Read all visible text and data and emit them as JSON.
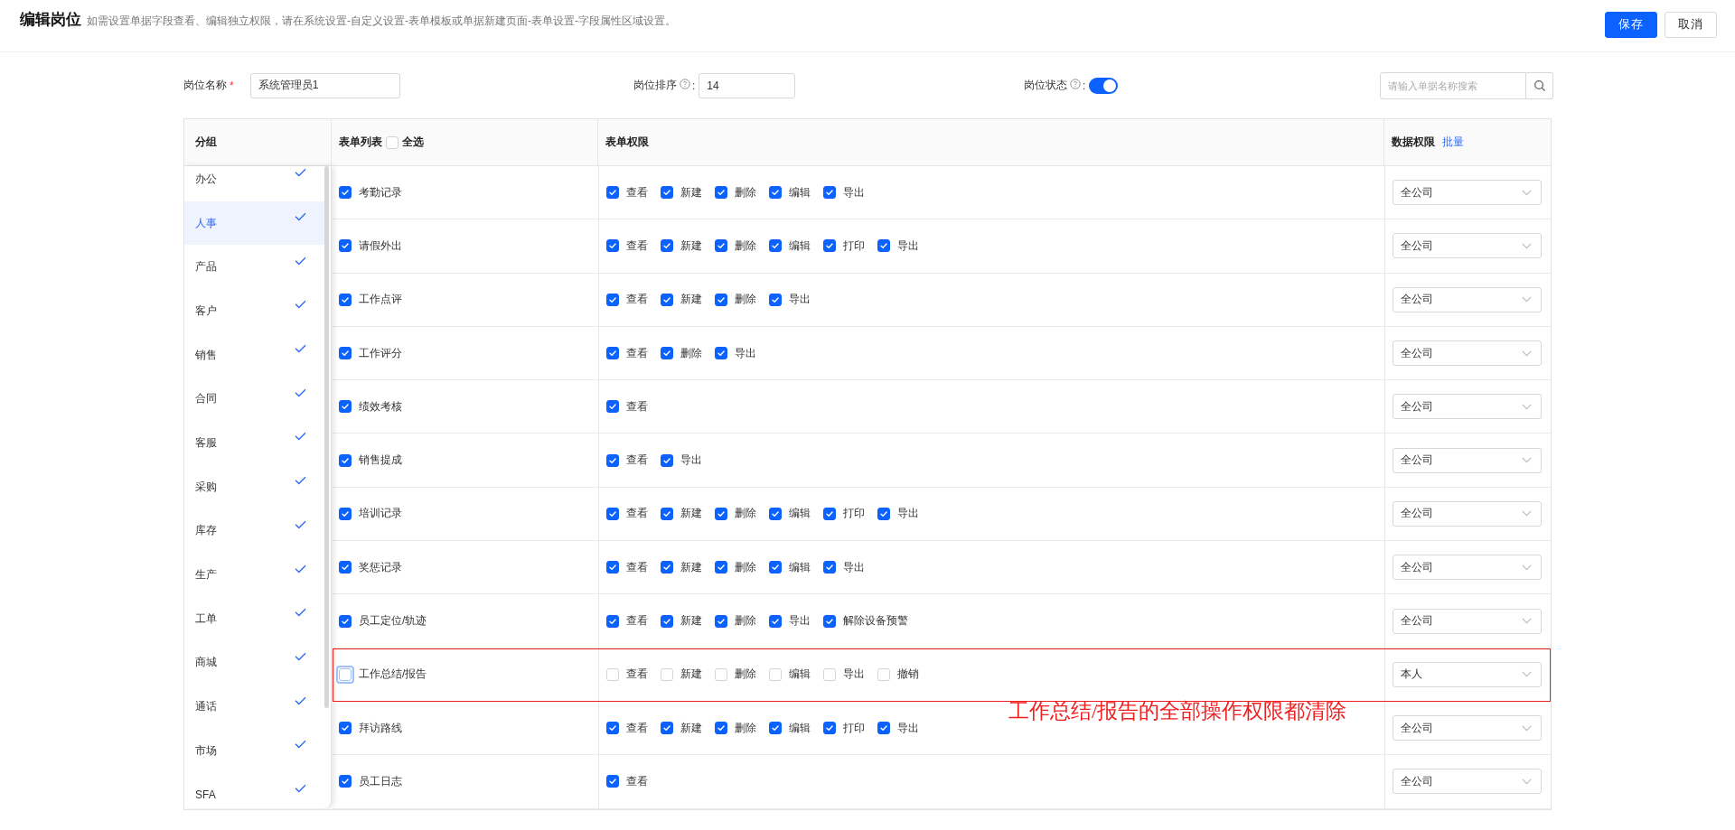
{
  "header": {
    "title": "编辑岗位",
    "subtitle": "如需设置单据字段查看、编辑独立权限，请在系统设置-自定义设置-表单模板或单据新建页面-表单设置-字段属性区域设置。",
    "buttons": [
      {
        "label": "保存",
        "kind": "primary"
      },
      {
        "label": "取消",
        "kind": "default"
      }
    ]
  },
  "form": {
    "name": {
      "label": "岗位名称",
      "required_mark": "*",
      "value": "系统管理员1"
    },
    "order": {
      "label": "岗位排序",
      "separator": ":",
      "value": "14"
    },
    "status": {
      "label": "岗位状态",
      "separator": ":",
      "on": true
    },
    "search": {
      "placeholder": "请输入单据名称搜索"
    }
  },
  "table": {
    "columns": {
      "group": "分组",
      "forms": "表单列表",
      "select_all": {
        "label": "全选",
        "checked": false
      },
      "permissions": "表单权限",
      "scope": "数据权限",
      "batch_link": "批量"
    },
    "groups": [
      {
        "label": "办公",
        "selected": false,
        "checked": true
      },
      {
        "label": "人事",
        "selected": true,
        "checked": true
      },
      {
        "label": "产品",
        "selected": false,
        "checked": true
      },
      {
        "label": "客户",
        "selected": false,
        "checked": true
      },
      {
        "label": "销售",
        "selected": false,
        "checked": true
      },
      {
        "label": "合同",
        "selected": false,
        "checked": true
      },
      {
        "label": "客服",
        "selected": false,
        "checked": true
      },
      {
        "label": "采购",
        "selected": false,
        "checked": true
      },
      {
        "label": "库存",
        "selected": false,
        "checked": true
      },
      {
        "label": "生产",
        "selected": false,
        "checked": true
      },
      {
        "label": "工单",
        "selected": false,
        "checked": true
      },
      {
        "label": "商城",
        "selected": false,
        "checked": true
      },
      {
        "label": "通话",
        "selected": false,
        "checked": true
      },
      {
        "label": "市场",
        "selected": false,
        "checked": true
      },
      {
        "label": "SFA",
        "selected": false,
        "checked": true
      }
    ],
    "rows": [
      {
        "name": "考勤记录",
        "checked": true,
        "focused": false,
        "highlighted": false,
        "scope": "全公司",
        "permissions": [
          {
            "label": "查看",
            "checked": true
          },
          {
            "label": "新建",
            "checked": true
          },
          {
            "label": "删除",
            "checked": true
          },
          {
            "label": "编辑",
            "checked": true
          },
          {
            "label": "导出",
            "checked": true
          }
        ]
      },
      {
        "name": "请假外出",
        "checked": true,
        "focused": false,
        "highlighted": false,
        "scope": "全公司",
        "permissions": [
          {
            "label": "查看",
            "checked": true
          },
          {
            "label": "新建",
            "checked": true
          },
          {
            "label": "删除",
            "checked": true
          },
          {
            "label": "编辑",
            "checked": true
          },
          {
            "label": "打印",
            "checked": true
          },
          {
            "label": "导出",
            "checked": true
          }
        ]
      },
      {
        "name": "工作点评",
        "checked": true,
        "focused": false,
        "highlighted": false,
        "scope": "全公司",
        "permissions": [
          {
            "label": "查看",
            "checked": true
          },
          {
            "label": "新建",
            "checked": true
          },
          {
            "label": "删除",
            "checked": true
          },
          {
            "label": "导出",
            "checked": true
          }
        ]
      },
      {
        "name": "工作评分",
        "checked": true,
        "focused": false,
        "highlighted": false,
        "scope": "全公司",
        "permissions": [
          {
            "label": "查看",
            "checked": true
          },
          {
            "label": "删除",
            "checked": true
          },
          {
            "label": "导出",
            "checked": true
          }
        ]
      },
      {
        "name": "绩效考核",
        "checked": true,
        "focused": false,
        "highlighted": false,
        "scope": "全公司",
        "permissions": [
          {
            "label": "查看",
            "checked": true
          }
        ]
      },
      {
        "name": "销售提成",
        "checked": true,
        "focused": false,
        "highlighted": false,
        "scope": "全公司",
        "permissions": [
          {
            "label": "查看",
            "checked": true
          },
          {
            "label": "导出",
            "checked": true
          }
        ]
      },
      {
        "name": "培训记录",
        "checked": true,
        "focused": false,
        "highlighted": false,
        "scope": "全公司",
        "permissions": [
          {
            "label": "查看",
            "checked": true
          },
          {
            "label": "新建",
            "checked": true
          },
          {
            "label": "删除",
            "checked": true
          },
          {
            "label": "编辑",
            "checked": true
          },
          {
            "label": "打印",
            "checked": true
          },
          {
            "label": "导出",
            "checked": true
          }
        ]
      },
      {
        "name": "奖惩记录",
        "checked": true,
        "focused": false,
        "highlighted": false,
        "scope": "全公司",
        "permissions": [
          {
            "label": "查看",
            "checked": true
          },
          {
            "label": "新建",
            "checked": true
          },
          {
            "label": "删除",
            "checked": true
          },
          {
            "label": "编辑",
            "checked": true
          },
          {
            "label": "导出",
            "checked": true
          }
        ]
      },
      {
        "name": "员工定位/轨迹",
        "checked": true,
        "focused": false,
        "highlighted": false,
        "scope": "全公司",
        "permissions": [
          {
            "label": "查看",
            "checked": true
          },
          {
            "label": "新建",
            "checked": true
          },
          {
            "label": "删除",
            "checked": true
          },
          {
            "label": "导出",
            "checked": true
          },
          {
            "label": "解除设备预警",
            "checked": true
          }
        ]
      },
      {
        "name": "工作总结/报告",
        "checked": false,
        "focused": true,
        "highlighted": true,
        "scope": "本人",
        "permissions": [
          {
            "label": "查看",
            "checked": false
          },
          {
            "label": "新建",
            "checked": false
          },
          {
            "label": "删除",
            "checked": false
          },
          {
            "label": "编辑",
            "checked": false
          },
          {
            "label": "导出",
            "checked": false
          },
          {
            "label": "撤销",
            "checked": false
          }
        ]
      },
      {
        "name": "拜访路线",
        "checked": true,
        "focused": false,
        "highlighted": false,
        "scope": "全公司",
        "permissions": [
          {
            "label": "查看",
            "checked": true
          },
          {
            "label": "新建",
            "checked": true
          },
          {
            "label": "删除",
            "checked": true
          },
          {
            "label": "编辑",
            "checked": true
          },
          {
            "label": "打印",
            "checked": true
          },
          {
            "label": "导出",
            "checked": true
          }
        ]
      },
      {
        "name": "员工日志",
        "checked": true,
        "focused": false,
        "highlighted": false,
        "scope": "全公司",
        "permissions": [
          {
            "label": "查看",
            "checked": true
          }
        ]
      }
    ]
  },
  "annotation": {
    "text": "工作总结/报告的全部操作权限都清除"
  }
}
